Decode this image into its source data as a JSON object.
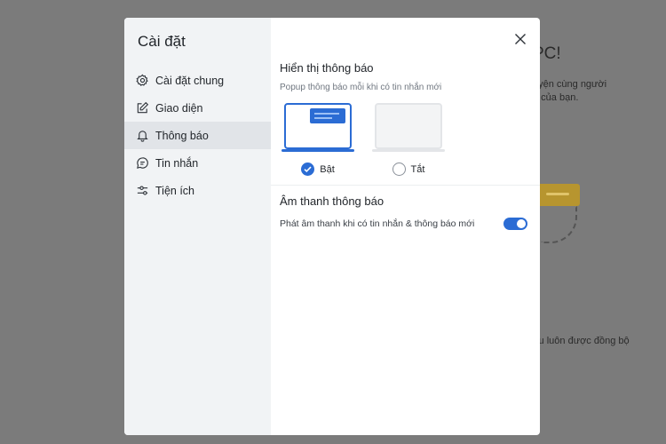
{
  "background": {
    "title": "PC!",
    "line1": "uyện cùng người",
    "line2": "n của bạn.",
    "line3": "iệu luôn được đồng bộ"
  },
  "modal": {
    "title": "Cài đặt",
    "close_icon": "close-icon"
  },
  "sidebar": {
    "items": [
      {
        "label": "Cài đặt chung",
        "icon": "gear-icon",
        "active": false
      },
      {
        "label": "Giao diện",
        "icon": "edit-icon",
        "active": false
      },
      {
        "label": "Thông báo",
        "icon": "bell-icon",
        "active": true
      },
      {
        "label": "Tin nhắn",
        "icon": "chat-icon",
        "active": false
      },
      {
        "label": "Tiện ích",
        "icon": "sliders-icon",
        "active": false
      }
    ]
  },
  "notifications": {
    "title": "Hiển thị thông báo",
    "description": "Popup thông báo mỗi khi có tin nhắn mới",
    "options": [
      {
        "label": "Bật",
        "selected": true
      },
      {
        "label": "Tắt",
        "selected": false
      }
    ]
  },
  "sound": {
    "title": "Âm thanh thông báo",
    "label": "Phát âm thanh khi có tin nhắn & thông báo mới",
    "enabled": true
  },
  "colors": {
    "accent": "#2b6cd4",
    "sidebar_bg": "#f1f3f5",
    "overlay": "#7b7b7b"
  }
}
